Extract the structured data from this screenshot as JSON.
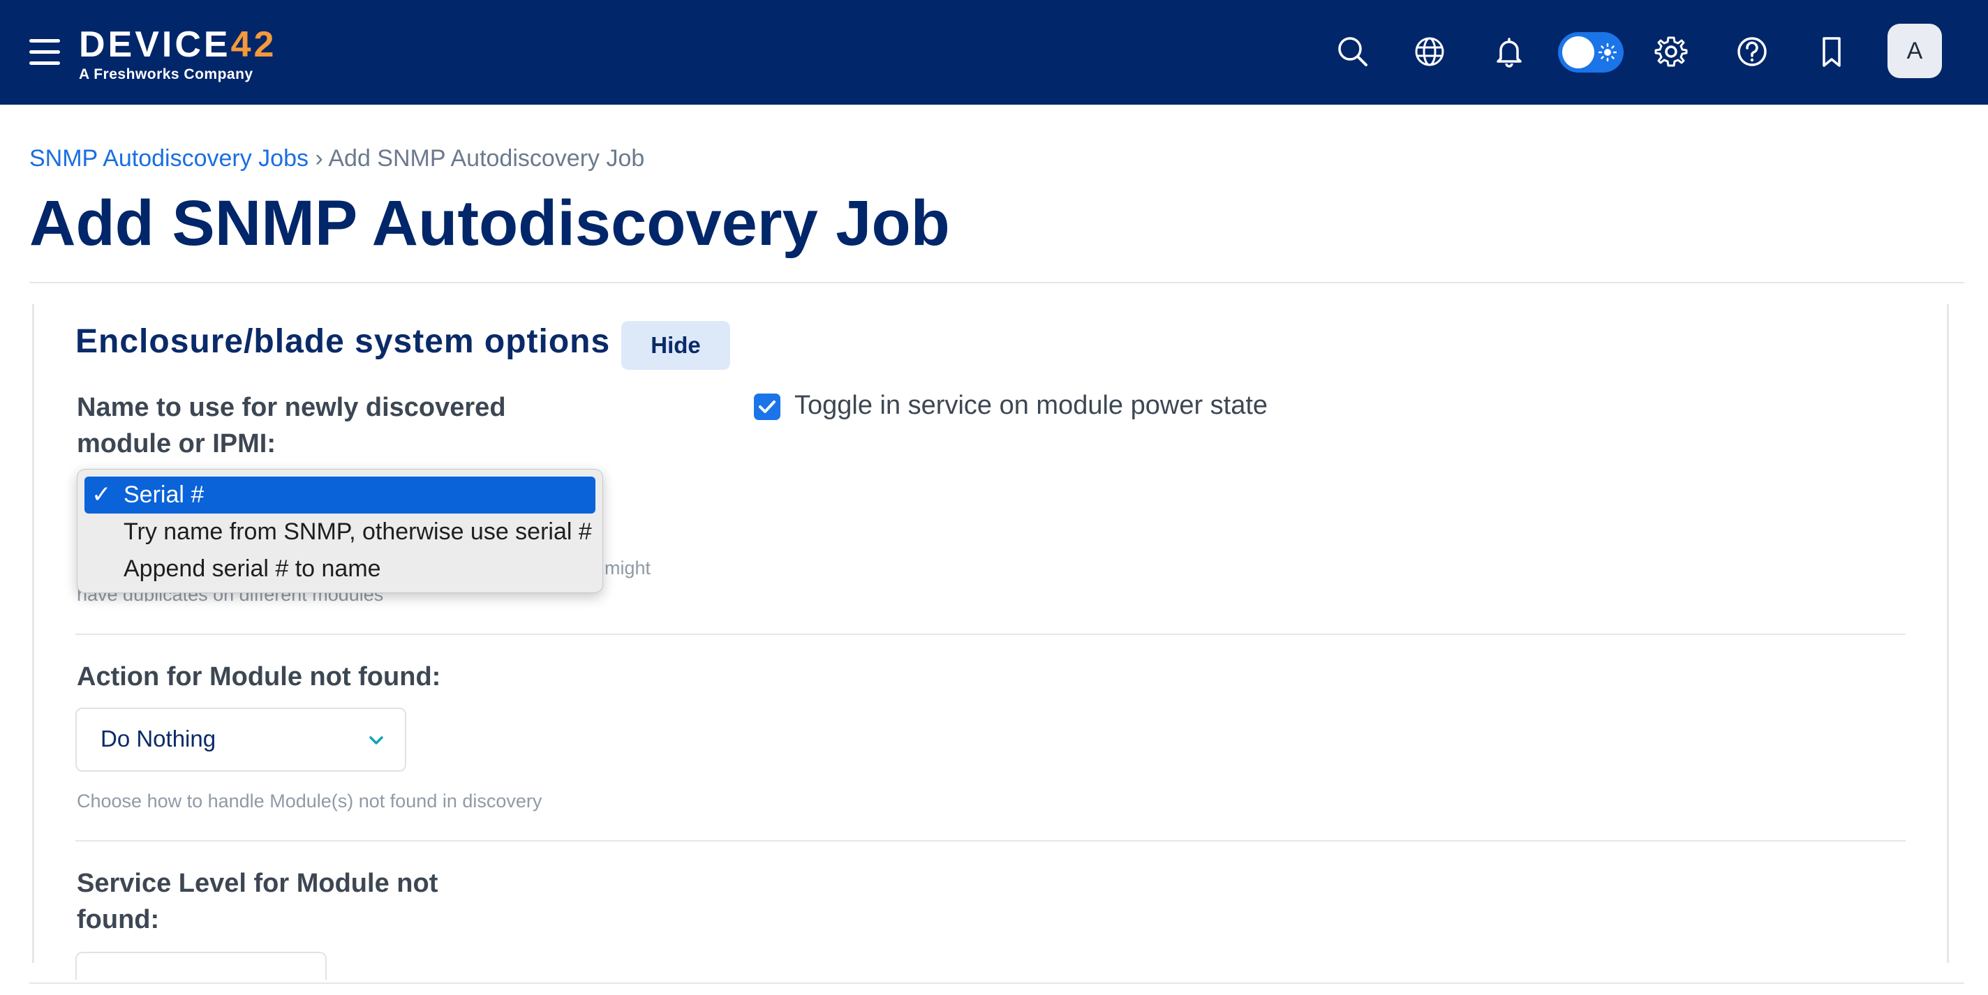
{
  "header": {
    "logo_text": "DEVICE",
    "logo_num": "42",
    "logo_sub": "A Freshworks Company",
    "avatar_initial": "A",
    "icons": [
      "menu-icon",
      "search-icon",
      "globe-icon",
      "bell-icon",
      "theme-toggle",
      "gear-icon",
      "help-icon",
      "bookmark-icon"
    ],
    "brand_color": "#02266a",
    "accent_color": "#f29a3c"
  },
  "breadcrumb": {
    "parent": "SNMP Autodiscovery Jobs",
    "separator": "›",
    "current": "Add SNMP Autodiscovery Job"
  },
  "page": {
    "title": "Add SNMP Autodiscovery Job"
  },
  "section": {
    "title": "Enclosure/blade system options",
    "hide_label": "Hide"
  },
  "fields": {
    "name_to_use": {
      "label_line1": "Name to use for newly discovered",
      "label_line2": "module or IPMI:",
      "options": [
        "Serial #",
        "Try name from SNMP, otherwise use serial #",
        "Append serial # to name"
      ],
      "selected": "Serial #",
      "hint_line1_tail": "might",
      "hint_line2": "have duplicates on different modules"
    },
    "toggle_in_service": {
      "label": "Toggle in service on module power state",
      "checked": true
    },
    "action_not_found": {
      "label": "Action for Module not found:",
      "value": "Do Nothing",
      "hint": "Choose how to handle Module(s) not found in discovery"
    },
    "service_level_not_found": {
      "label_line1": "Service Level for Module not",
      "label_line2": "found:"
    }
  }
}
